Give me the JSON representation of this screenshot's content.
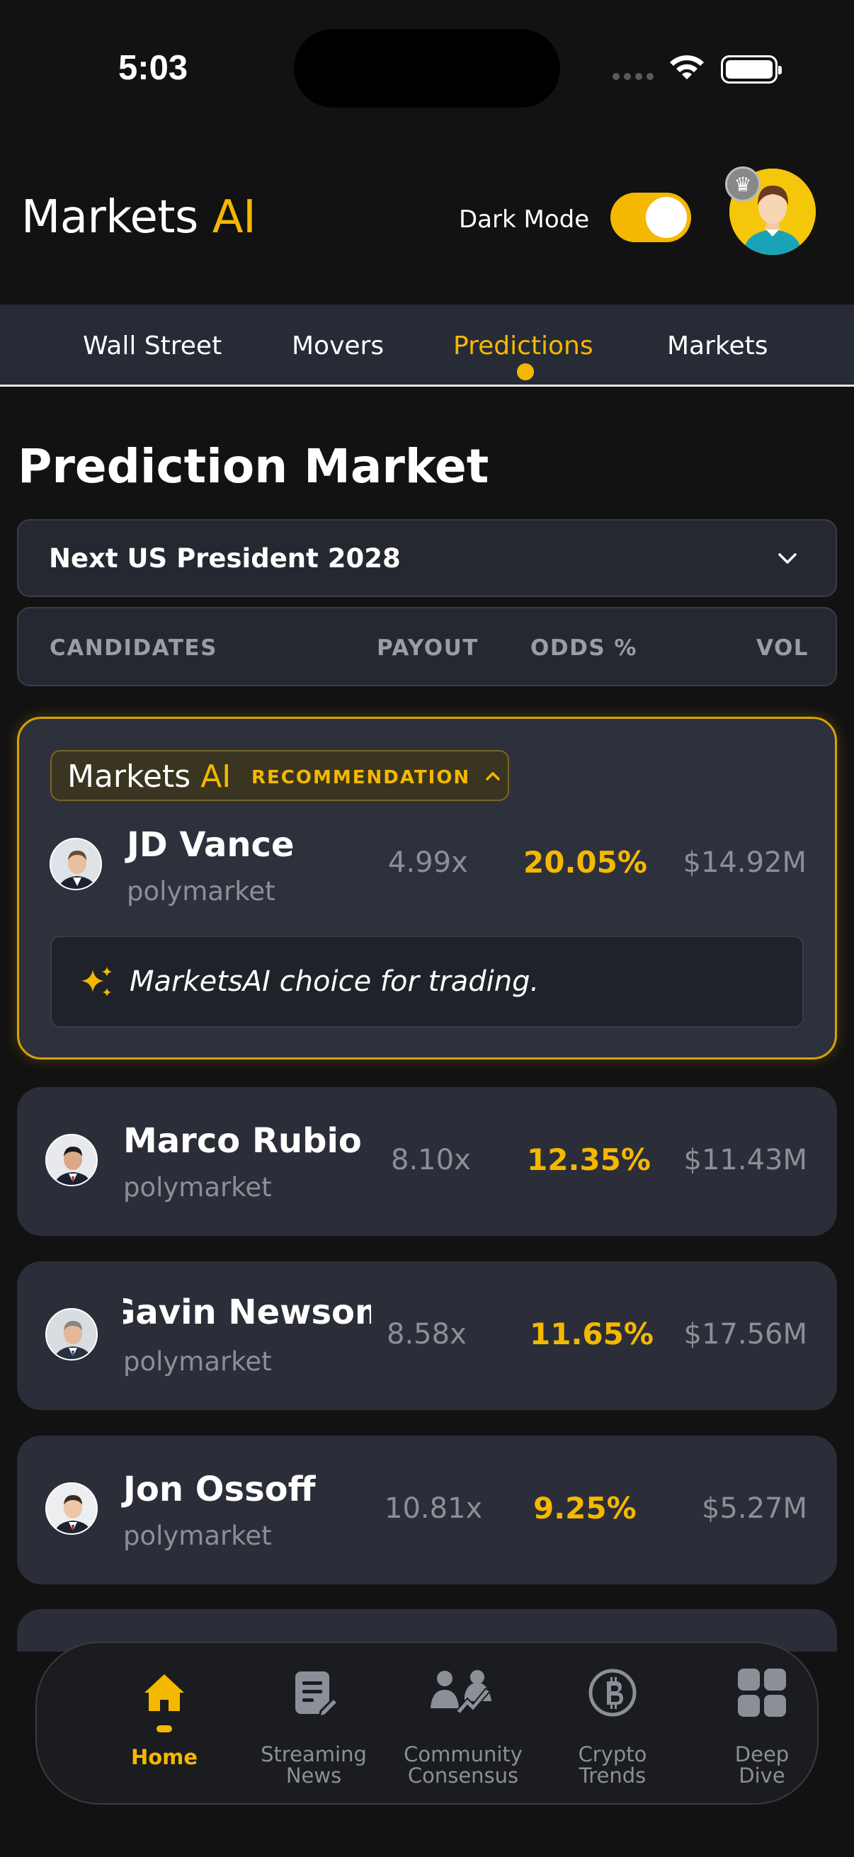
{
  "status_bar": {
    "time": "5:03"
  },
  "header": {
    "brand_main": "Markets",
    "brand_accent": "AI",
    "dark_mode_label": "Dark Mode",
    "dark_mode_on": true
  },
  "tabs": [
    {
      "label": "Wall Street"
    },
    {
      "label": "Movers"
    },
    {
      "label": "Predictions",
      "active": true
    },
    {
      "label": "Markets"
    }
  ],
  "page_title": "Prediction Market",
  "market_selector": {
    "value": "Next US President 2028"
  },
  "columns": {
    "candidates": "CANDIDATES",
    "payout": "PAYOUT",
    "odds": "ODDS %",
    "vol": "VOL"
  },
  "recommendation": {
    "brand_main": "Markets",
    "brand_accent": "AI",
    "label": "RECOMMENDATION",
    "choice_text": "MarketsAI choice for trading."
  },
  "candidates": [
    {
      "name": "JD Vance",
      "source": "polymarket",
      "payout": "4.99x",
      "odds": "20.05%",
      "vol": "$14.92M",
      "featured": true
    },
    {
      "name": "Marco Rubio",
      "source": "polymarket",
      "payout": "8.10x",
      "odds": "12.35%",
      "vol": "$11.43M"
    },
    {
      "name": "Gavin Newsom",
      "source": "polymarket",
      "payout": "8.58x",
      "odds": "11.65%",
      "vol": "$17.56M"
    },
    {
      "name": "Jon Ossoff",
      "source": "polymarket",
      "payout": "10.81x",
      "odds": "9.25%",
      "vol": "$5.27M"
    }
  ],
  "bottom_nav": [
    {
      "label": "Home",
      "icon": "home-icon",
      "active": true
    },
    {
      "label": "Streaming News",
      "icon": "news-icon"
    },
    {
      "label": "Community Consensus",
      "icon": "community-icon"
    },
    {
      "label": "Crypto Trends",
      "icon": "bitcoin-icon"
    },
    {
      "label": "Deep Dive",
      "icon": "grid-icon"
    }
  ],
  "colors": {
    "accent": "#f5b800",
    "background": "#121212",
    "card": "#2b2e38"
  }
}
